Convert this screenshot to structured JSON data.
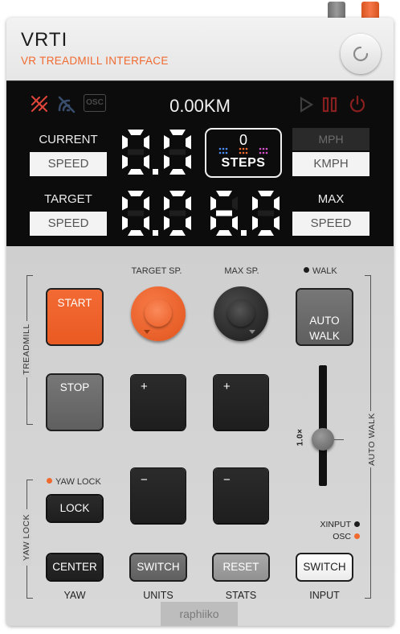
{
  "header": {
    "title": "VRTI",
    "subtitle": "VR TREADMILL INTERFACE"
  },
  "display": {
    "distance": "0.00KM",
    "indicators": {
      "osc": "OSC"
    },
    "current": {
      "label": "CURRENT",
      "box": "SPEED",
      "value": "0.0"
    },
    "target": {
      "label": "TARGET",
      "box": "SPEED",
      "value": "0.0"
    },
    "max": {
      "label": "MAX",
      "box": "SPEED",
      "value": "6.0"
    },
    "steps": {
      "count": "0",
      "label": "STEPS"
    },
    "units": {
      "mph": "MPH",
      "kmph": "KMPH",
      "selected": "KMPH"
    }
  },
  "controls": {
    "start": "START",
    "stop": "STOP",
    "auto_walk": "AUTO\nWALK",
    "target_knob_label": "TARGET SP.",
    "max_knob_label": "MAX SP.",
    "walk_indicator": "WALK",
    "target_plus": "+",
    "target_minus": "−",
    "max_plus": "+",
    "max_minus": "−",
    "slider_value": "1.0×",
    "yaw_lock_indicator": "YAW LOCK",
    "lock": "LOCK",
    "center": "CENTER",
    "switch_units": "SWITCH",
    "reset": "RESET",
    "switch_input": "SWITCH",
    "xinput_indicator": "XINPUT",
    "osc_indicator": "OSC"
  },
  "section_labels": {
    "treadmill": "TREADMILL",
    "yaw_lock": "YAW LOCK",
    "auto_walk": "AUTO WALK",
    "yaw": "YAW",
    "units": "UNITS",
    "stats": "STATS",
    "input": "INPUT"
  },
  "footer": {
    "credit": "raphiiko"
  },
  "colors": {
    "accent": "#f06a30",
    "led_off": "#2a2a2a",
    "segment": "#ffffff"
  }
}
